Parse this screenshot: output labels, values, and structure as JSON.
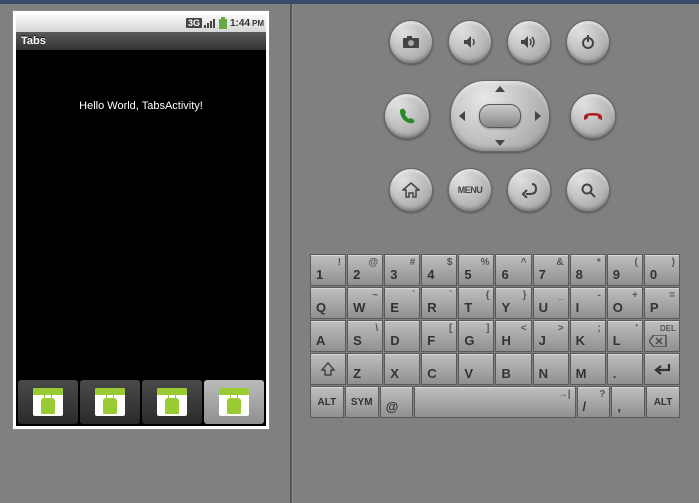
{
  "status_bar": {
    "network": "3G",
    "time": "1:44",
    "ampm": "PM"
  },
  "title_bar": {
    "title": "Tabs"
  },
  "content": {
    "text": "Hello World, TabsActivity!"
  },
  "tabs": [
    {
      "active": false
    },
    {
      "active": false
    },
    {
      "active": false
    },
    {
      "active": true
    }
  ],
  "controls": {
    "row1": [
      "camera",
      "vol-down",
      "vol-up",
      "power"
    ],
    "row2": [
      "call",
      "dpad",
      "end-call"
    ],
    "row3": [
      "home",
      "menu",
      "back",
      "search"
    ],
    "menu_label": "MENU"
  },
  "keyboard": {
    "rows": [
      [
        {
          "main": "1",
          "sec": "!"
        },
        {
          "main": "2",
          "sec": "@"
        },
        {
          "main": "3",
          "sec": "#"
        },
        {
          "main": "4",
          "sec": "$"
        },
        {
          "main": "5",
          "sec": "%"
        },
        {
          "main": "6",
          "sec": "^"
        },
        {
          "main": "7",
          "sec": "&"
        },
        {
          "main": "8",
          "sec": "*"
        },
        {
          "main": "9",
          "sec": "("
        },
        {
          "main": "0",
          "sec": ")"
        }
      ],
      [
        {
          "main": "Q",
          "sec": ""
        },
        {
          "main": "W",
          "sec": "~"
        },
        {
          "main": "E",
          "sec": "`"
        },
        {
          "main": "R",
          "sec": "`"
        },
        {
          "main": "T",
          "sec": "{"
        },
        {
          "main": "Y",
          "sec": "}"
        },
        {
          "main": "U",
          "sec": "_"
        },
        {
          "main": "I",
          "sec": "-"
        },
        {
          "main": "O",
          "sec": "+"
        },
        {
          "main": "P",
          "sec": "="
        }
      ],
      [
        {
          "main": "A",
          "sec": ""
        },
        {
          "main": "S",
          "sec": "\\"
        },
        {
          "main": "D",
          "sec": ""
        },
        {
          "main": "F",
          "sec": "["
        },
        {
          "main": "G",
          "sec": "]"
        },
        {
          "main": "H",
          "sec": "<"
        },
        {
          "main": "J",
          "sec": ">"
        },
        {
          "main": "K",
          "sec": ";"
        },
        {
          "main": "L",
          "sec": "'"
        },
        {
          "main": "DEL",
          "sec": "",
          "icon": "del"
        }
      ],
      [
        {
          "main": "⇧",
          "sec": "",
          "icon": "shift"
        },
        {
          "main": "Z",
          "sec": ""
        },
        {
          "main": "X",
          "sec": ""
        },
        {
          "main": "C",
          "sec": ""
        },
        {
          "main": "V",
          "sec": ""
        },
        {
          "main": "B",
          "sec": ""
        },
        {
          "main": "N",
          "sec": ""
        },
        {
          "main": "M",
          "sec": ""
        },
        {
          "main": ".",
          "sec": ""
        },
        {
          "main": "↵",
          "sec": "",
          "icon": "enter"
        }
      ],
      [
        {
          "main": "ALT",
          "sec": "",
          "cls": "sm"
        },
        {
          "main": "SYM",
          "sec": "",
          "cls": "sm"
        },
        {
          "main": "@",
          "sec": ""
        },
        {
          "main": "",
          "sec": "→|",
          "cls": "wide5 space"
        },
        {
          "main": "/",
          "sec": "?"
        },
        {
          "main": ",",
          "sec": ""
        },
        {
          "main": "ALT",
          "sec": "",
          "cls": "sm"
        }
      ]
    ]
  }
}
